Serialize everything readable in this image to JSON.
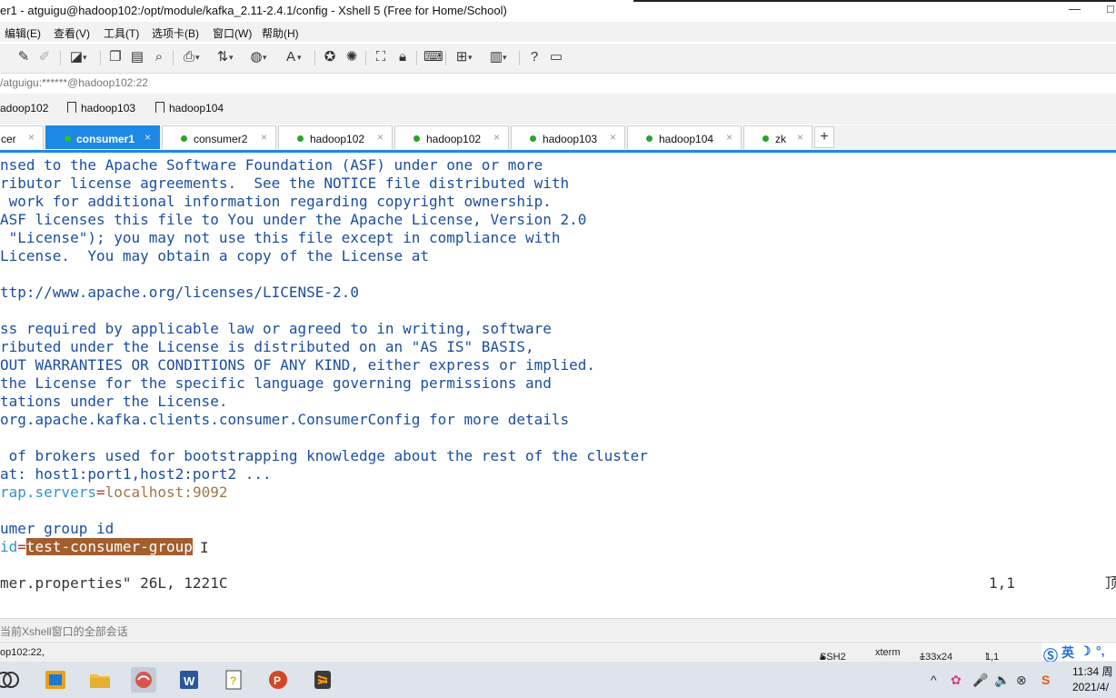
{
  "window": {
    "title": "er1 - atguigu@hadoop102:/opt/module/kafka_2.11-2.4.1/config - Xshell 5 (Free for Home/School)",
    "minimize_glyph": "—",
    "maximize_glyph": "□"
  },
  "menu": [
    "编辑(E)",
    "查看(V)",
    "工具(T)",
    "选项卡(B)",
    "窗口(W)",
    "帮助(H)"
  ],
  "toolbar_icons": [
    "pen-icon",
    "eraser-icon",
    "new-session-icon",
    "copy-icon",
    "paste-icon",
    "find-icon",
    "print-icon",
    "transfer-icon",
    "globe-icon",
    "font-icon",
    "script-icon",
    "record-icon",
    "fullscreen-icon",
    "lock-icon",
    "keyboard-icon",
    "compose-icon",
    "layout-icon",
    "help-icon",
    "chat-icon"
  ],
  "address": "/atguigu:******@hadoop102:22",
  "links": [
    "adoop102",
    "hadoop103",
    "hadoop104"
  ],
  "tabs": [
    {
      "label": "cer",
      "active": false,
      "dot": false
    },
    {
      "label": "consumer1",
      "active": true,
      "dot": true
    },
    {
      "label": "consumer2",
      "active": false,
      "dot": true
    },
    {
      "label": "hadoop102",
      "active": false,
      "dot": true
    },
    {
      "label": "hadoop102",
      "active": false,
      "dot": true
    },
    {
      "label": "hadoop103",
      "active": false,
      "dot": true
    },
    {
      "label": "hadoop104",
      "active": false,
      "dot": true
    },
    {
      "label": "zk",
      "active": false,
      "dot": true
    }
  ],
  "tab_close_glyph": "×",
  "tab_add_glyph": "+",
  "terminal": {
    "lines": [
      "nsed to the Apache Software Foundation (ASF) under one or more",
      "ributor license agreements.  See the NOTICE file distributed with",
      " work for additional information regarding copyright ownership.",
      "ASF licenses this file to You under the Apache License, Version 2.0",
      " \"License\"); you may not use this file except in compliance with",
      "License.  You may obtain a copy of the License at",
      "",
      "ttp://www.apache.org/licenses/LICENSE-2.0",
      "",
      "ss required by applicable law or agreed to in writing, software",
      "ributed under the License is distributed on an \"AS IS\" BASIS,",
      "OUT WARRANTIES OR CONDITIONS OF ANY KIND, either express or implied.",
      "the License for the specific language governing permissions and",
      "tations under the License.",
      "org.apache.kafka.clients.consumer.ConsumerConfig for more details",
      "",
      " of brokers used for bootstrapping knowledge about the rest of the cluster",
      "at: host1:port1,host2:port2 ...",
      "",
      "",
      "umer group id",
      "",
      ""
    ],
    "bootstrap": {
      "key": "rap.servers",
      "eq": "=",
      "value": "localhost:9092"
    },
    "groupid": {
      "key": "id",
      "eq": "=",
      "value": "test-consumer-group"
    },
    "status_left": "mer.properties\" 26L, 1221C",
    "status_pos": "1,1",
    "status_right": "顶",
    "cursor_glyph": "I"
  },
  "session_bar": "当前Xshell窗口的全部会话",
  "statusbar": {
    "left": "op102:22,",
    "proto": "SSH2",
    "term": "xterm",
    "size": "133x24",
    "pos": "1,1"
  },
  "ime": [
    "英",
    "☽",
    "°,"
  ],
  "taskbar_apps": [
    "start-icon",
    "xshell-manager-icon",
    "file-explorer-icon",
    "xshell-icon",
    "word-icon",
    "notepad-icon",
    "powerpoint-icon",
    "sublime-icon"
  ],
  "tray": [
    "^",
    "✿",
    "🎤",
    "🔈",
    "⊗",
    "S"
  ],
  "clock": {
    "time": "11:34 周",
    "date": "2021/4/"
  },
  "colors": {
    "accent": "#1e88e5",
    "selection": "#a35e2e",
    "comment": "#1a4ea0"
  }
}
